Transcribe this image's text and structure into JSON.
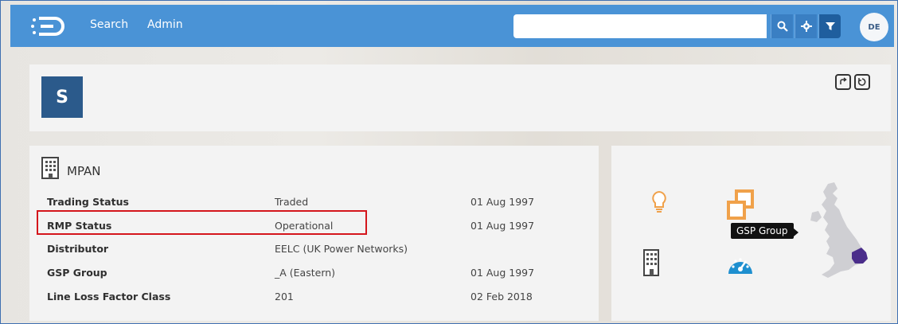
{
  "nav": {
    "search_label": "Search",
    "admin_label": "Admin"
  },
  "search": {
    "value": "",
    "placeholder": ""
  },
  "user": {
    "initials": "DE"
  },
  "header_card": {
    "letter": "S"
  },
  "mpan": {
    "title": "MPAN",
    "rows": [
      {
        "label": "Trading Status",
        "value": "Traded",
        "date": "01 Aug 1997"
      },
      {
        "label": "RMP Status",
        "value": "Operational",
        "date": "01 Aug 1997"
      },
      {
        "label": "Distributor",
        "value": "EELC (UK Power Networks)",
        "date": ""
      },
      {
        "label": "GSP Group",
        "value": "_A (Eastern)",
        "date": "01 Aug 1997"
      },
      {
        "label": "Line Loss Factor Class",
        "value": "201",
        "date": "02 Feb 2018"
      }
    ]
  },
  "tooltip": {
    "text": "GSP Group"
  },
  "icons": {
    "brand_logo": "logo-icon",
    "search": "search-icon",
    "gear": "gear-icon",
    "filter": "filter-icon",
    "building": "building-icon",
    "lightbulb": "lightbulb-icon",
    "group": "gsp-group-icon",
    "gauge": "gauge-icon",
    "map": "uk-map-icon"
  },
  "colors": {
    "topbar": "#4a93d6",
    "accent_dark": "#2b5a8b",
    "highlight": "#d4161c",
    "orange": "#f0a14a",
    "blue_icon": "#1e8fcf",
    "map_highlight": "#4a2d8a"
  }
}
